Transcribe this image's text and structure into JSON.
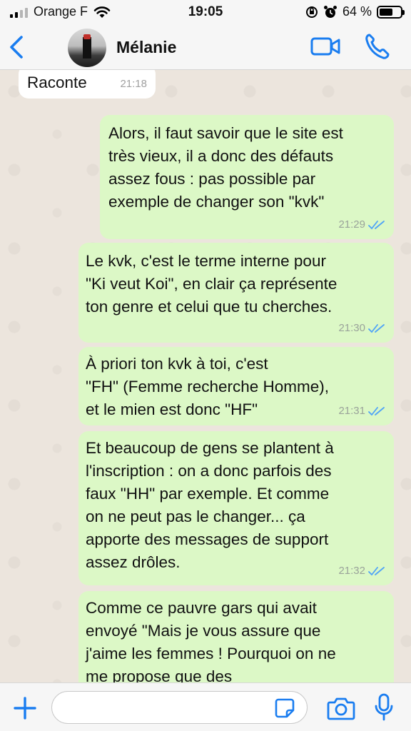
{
  "status_bar": {
    "carrier": "Orange F",
    "time": "19:05",
    "battery": "64 %",
    "battery_level": 0.64,
    "signal_bars_active": 2,
    "signal_bars_total": 4
  },
  "header": {
    "contact_name": "Mélanie",
    "icons": {
      "back": "chevron-left-icon",
      "video": "video-camera-icon",
      "call": "phone-icon"
    }
  },
  "messages": [
    {
      "direction": "in",
      "text": "Raconte",
      "time": "21:18"
    },
    {
      "direction": "out",
      "text": "Alors, il faut savoir que le site est\ntrès vieux, il a donc des défauts\nassez fous : pas possible par\nexemple de changer son \"kvk\"",
      "time": "21:29",
      "read": true
    },
    {
      "direction": "out",
      "text": "Le kvk, c'est le terme interne pour\n\"Ki veut Koi\", en clair ça représente\nton genre et celui que tu cherches.",
      "time": "21:30",
      "read": true
    },
    {
      "direction": "out",
      "text": "À priori ton kvk à toi, c'est\n\"FH\" (Femme recherche Homme),\net le mien est donc \"HF\"",
      "time": "21:31",
      "read": true
    },
    {
      "direction": "out",
      "text": "Et beaucoup de gens se plantent à\nl'inscription : on a donc parfois des\nfaux \"HH\" par exemple. Et comme\non ne peut pas le changer... ça\napporte des messages de support\nassez drôles.",
      "time": "21:32",
      "read": true
    },
    {
      "direction": "out",
      "text": "Comme ce pauvre gars qui avait\nenvoyé \"Mais je vous assure que\nj'aime les femmes ! Pourquoi on ne\nme propose que des",
      "time": "",
      "read": false
    }
  ],
  "colors": {
    "accent_blue": "#1a7df0",
    "outgoing_bubble": "#dcf8c6",
    "incoming_bubble": "#ffffff",
    "read_ticks": "#4fa3f7"
  },
  "input_bar": {
    "placeholder": "",
    "icons": {
      "plus": "plus-icon",
      "sticker": "sticker-icon",
      "camera": "camera-icon",
      "mic": "microphone-icon"
    }
  }
}
